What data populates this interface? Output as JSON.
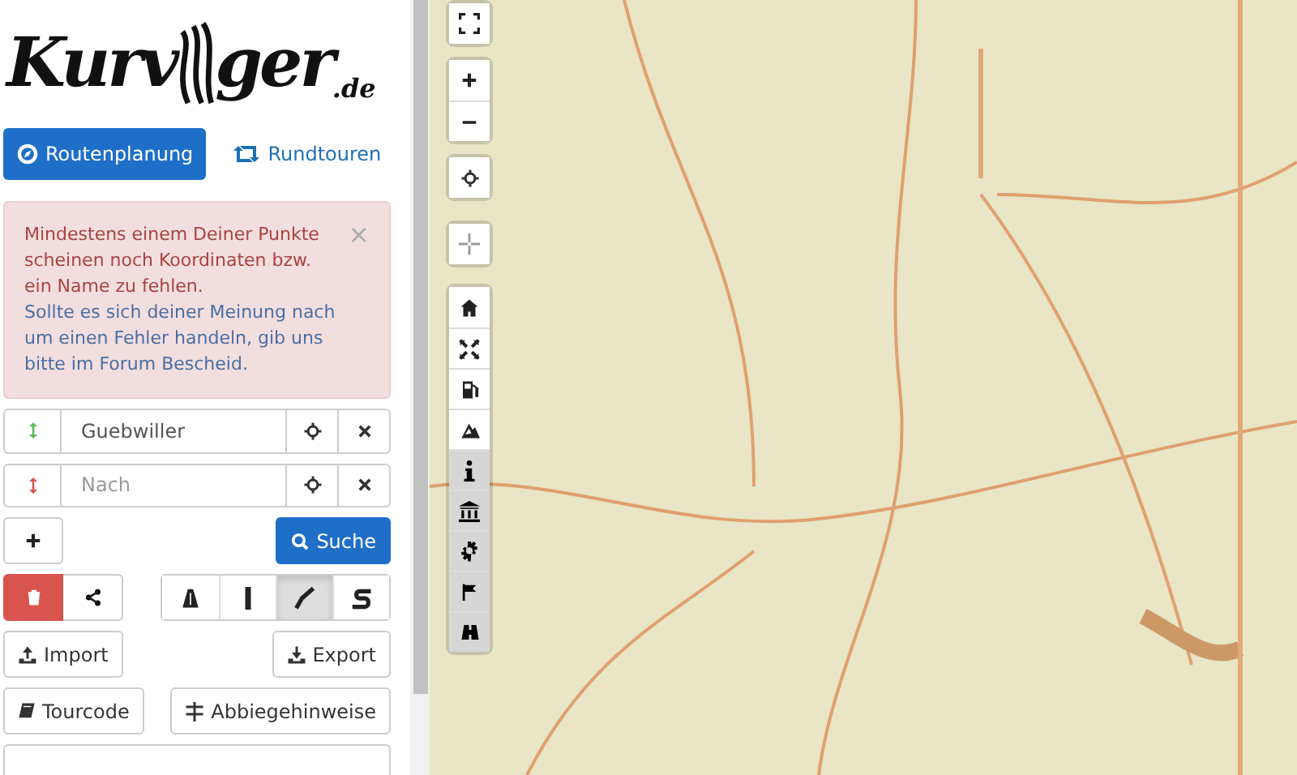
{
  "logo": {
    "part_1": "Kurv",
    "part_2": "ger",
    "suffix": ".de"
  },
  "tabs": [
    {
      "label": "Routenplanung",
      "selected": true
    },
    {
      "label": "Rundtouren",
      "selected": false
    }
  ],
  "alert": {
    "text": "Mindestens einem Deiner Punkte scheinen noch Koordinaten bzw. ein Name zu fehlen.",
    "link": "Sollte es sich deiner Meinung nach um einen Fehler handeln, gib uns bitte im Forum Bescheid.",
    "close": "×"
  },
  "waypoints": [
    {
      "value": "Guebwiller",
      "color": "#5cb85c"
    },
    {
      "placeholder": "Nach",
      "color": "#d9534f"
    }
  ],
  "search_button": "Suche",
  "route_styles": [
    {
      "selected": false
    },
    {
      "selected": false
    },
    {
      "selected": true
    },
    {
      "selected": false
    }
  ],
  "import_button": "Import",
  "export_button": "Export",
  "tourcode_button": "Tourcode",
  "directions_button": "Abbiegehinweise",
  "poi_toggles": [
    {
      "selected": true
    },
    {
      "selected": true
    },
    {
      "selected": true
    },
    {
      "selected": true
    },
    {
      "selected": false
    },
    {
      "selected": false
    },
    {
      "selected": false
    },
    {
      "selected": false
    },
    {
      "selected": false
    }
  ]
}
